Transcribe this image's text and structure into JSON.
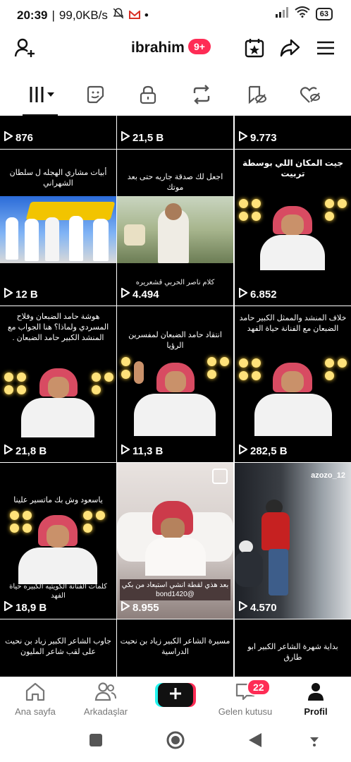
{
  "status": {
    "time": "20:39",
    "speed": "99,0KB/s",
    "battery": "63"
  },
  "header": {
    "username": "ibrahim",
    "badge": "9+"
  },
  "videos": [
    {
      "views": "876",
      "caption": ""
    },
    {
      "views": "21,5 B",
      "caption": ""
    },
    {
      "views": "9.773",
      "caption": ""
    },
    {
      "views": "12 B",
      "caption": "أبيات مشاري الهجله ل سلطان الشهراني"
    },
    {
      "views": "4.494",
      "caption": "اجعل لك صدقة جاريه حتى بعد موتك",
      "bottom": "كلام ناصر الحربي قشعريره"
    },
    {
      "views": "6.852",
      "caption": "جيت المكان اللي بوسطة تربيت"
    },
    {
      "views": "21,8 B",
      "caption": "هوشة حامد الضبعان وفلاح المسردي ولماذا؟ هنا الجواب مع المنشد الكبير حامد الضبعان ."
    },
    {
      "views": "11,3 B",
      "caption": "انتقاد حامد الضبعان لمفسرين الرؤيا"
    },
    {
      "views": "282,5 B",
      "caption": "خلاف المنشد والممثل الكبير حامد الضبعان مع الفنانة حياة الفهد"
    },
    {
      "views": "18,9 B",
      "caption": "ياسعود وش بك ماتسير علينا",
      "bottom": "كلمات الفنانة الكويتيه الكبيره حياة الفهد"
    },
    {
      "views": "8.955",
      "caption": "",
      "bottom": "بعد هذي لقطة انشي استبعاد من بكي @bond1420"
    },
    {
      "views": "4.570",
      "caption": "",
      "tag": "azozo_12"
    },
    {
      "views": "",
      "caption": "جاوب الشاعر الكبير زياد بن نحيت على لقب شاعر المليون"
    },
    {
      "views": "",
      "caption": "مسيرة الشاعر الكبير زياد بن نحيت الدراسية"
    },
    {
      "views": "",
      "caption": "بداية شهرة الشاعر الكبير ابو طارق"
    }
  ],
  "nav": {
    "home": "Ana sayfa",
    "friends": "Arkadaşlar",
    "inbox": "Gelen kutusu",
    "inbox_badge": "22",
    "profile": "Profil"
  }
}
